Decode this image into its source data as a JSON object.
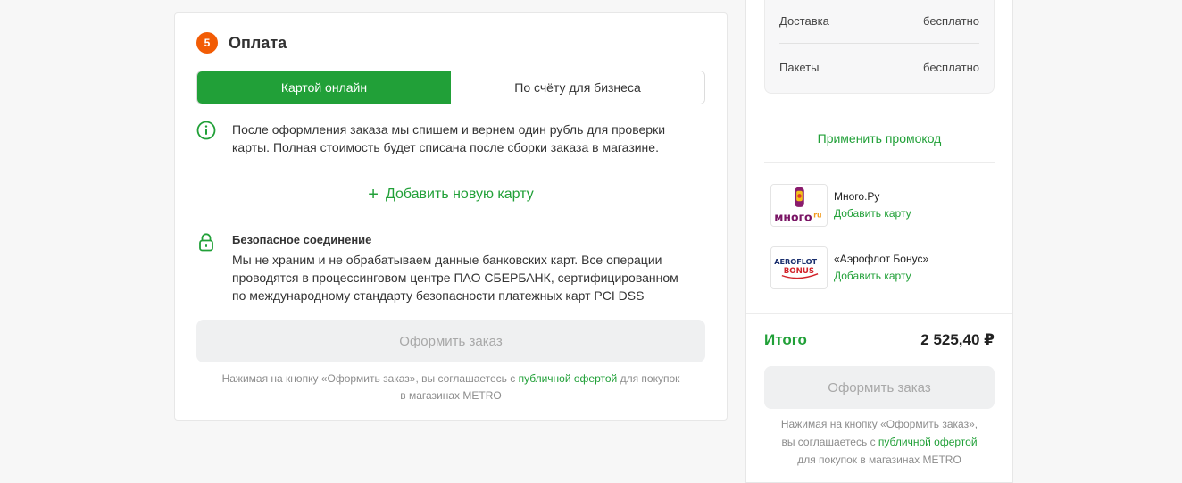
{
  "payment": {
    "step_number": "5",
    "title": "Оплата",
    "tabs": [
      {
        "label": "Картой онлайн",
        "active": true
      },
      {
        "label": "По счёту для бизнеса",
        "active": false
      }
    ],
    "info_line1": "После оформления заказа мы спишем и вернем один рубль для проверки",
    "info_line2": "карты. Полная стоимость будет списана после сборки заказа в магазине.",
    "add_card_label": "Добавить новую карту",
    "secure_title": "Безопасное соединение",
    "secure_line1": "Мы не храним и не обрабатываем данные банковских карт. Все операции",
    "secure_line2": "проводятся в процессинговом центре ПАО СБЕРБАНК, сертифицированном",
    "secure_line3": "по международному стандарту безопасности платежных карт PCI DSS",
    "order_button": "Оформить заказ",
    "agree_prefix": "Нажимая на кнопку «Оформить заказ», вы соглашаетесь с ",
    "agree_link": "публичной офертой",
    "agree_suffix": " для покупок",
    "agree_line2": "в магазинах METRO"
  },
  "summary": {
    "fees": [
      {
        "label": "Доставка",
        "value": "бесплатно"
      },
      {
        "label": "Пакеты",
        "value": "бесплатно"
      }
    ],
    "promo_label": "Применить промокод",
    "loyalty": [
      {
        "name": "Много.Ру",
        "action": "Добавить карту",
        "logo_text": "много",
        "logo_suffix": "ru"
      },
      {
        "name": "«Аэрофлот Бонус»",
        "action": "Добавить карту",
        "logo_text": "AEROFLOT",
        "logo_text2": "BONUS"
      }
    ],
    "total_label": "Итого",
    "total_value": "2 525,40 ₽",
    "order_button": "Оформить заказ",
    "agree_line1": "Нажимая на кнопку «Оформить заказ»,",
    "agree_line2_prefix": "вы соглашаетесь с ",
    "agree_link": "публичной офертой",
    "agree_line3": "для покупок в магазинах METRO"
  },
  "colors": {
    "accent": "#21a038",
    "step_badge": "#f25c05",
    "disabled_button": "#eff0f1"
  }
}
